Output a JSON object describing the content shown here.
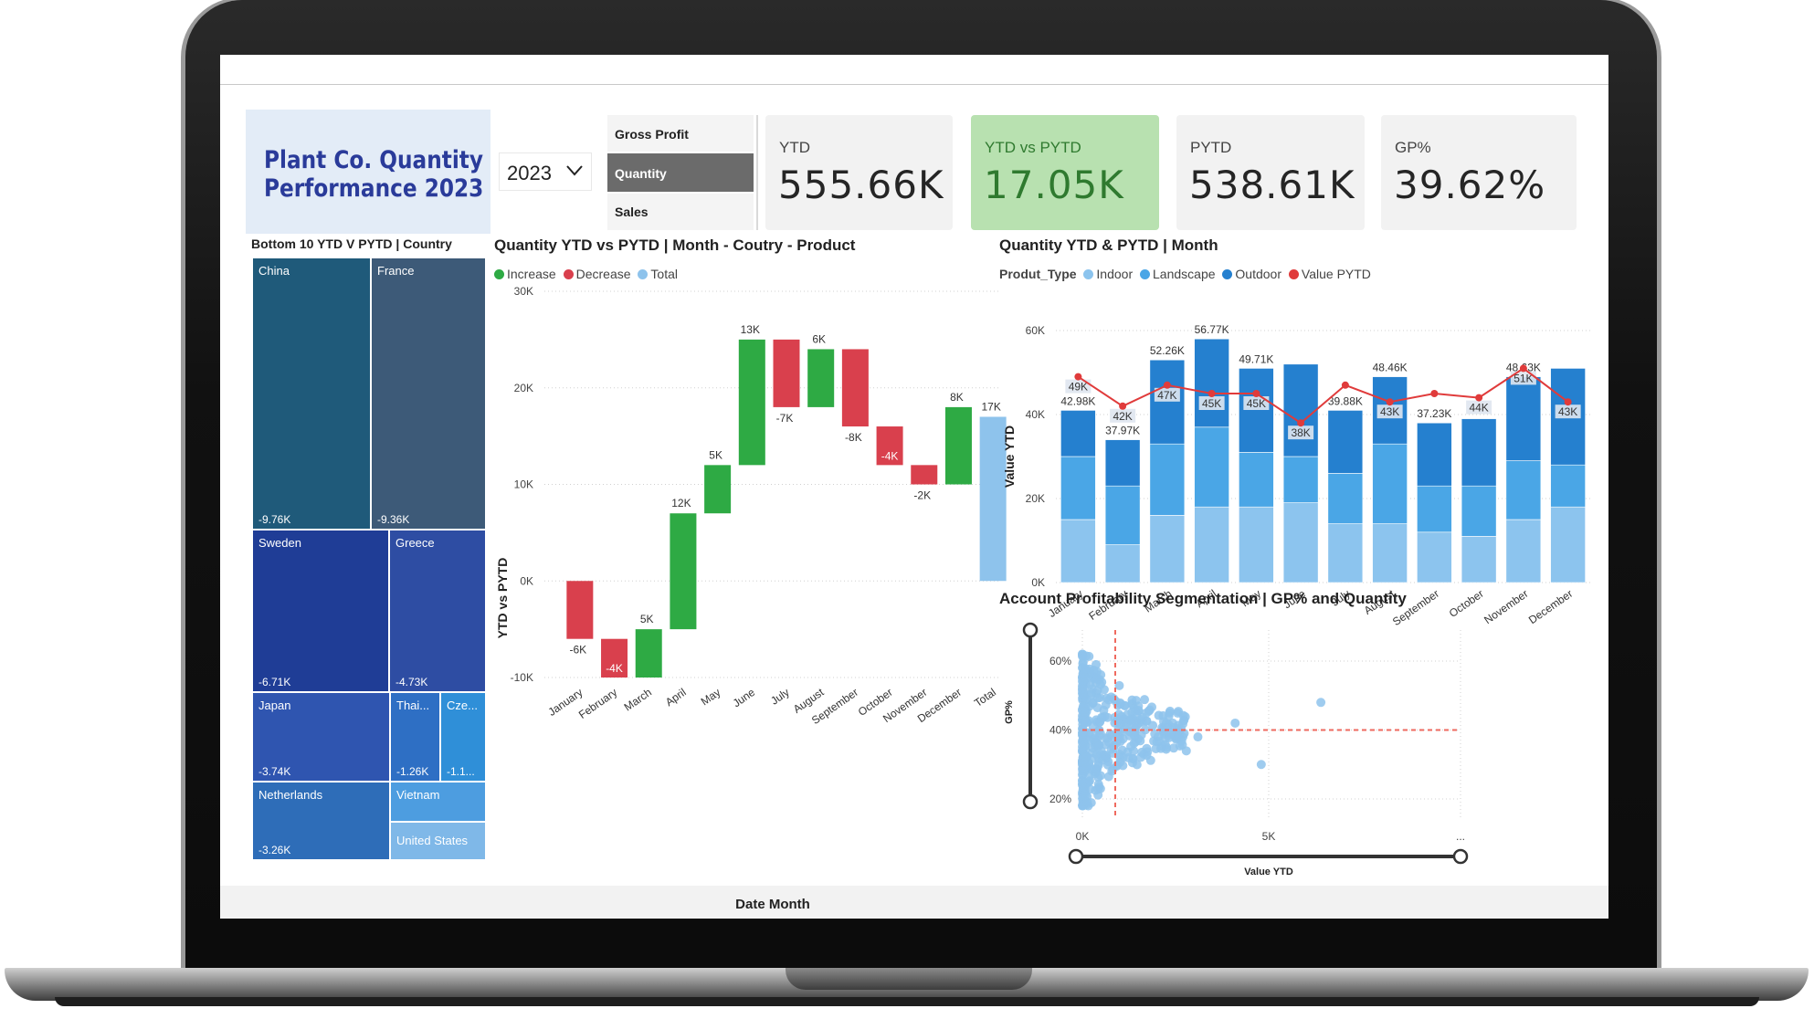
{
  "header": {
    "title_line1": "Plant Co. Quantity",
    "title_line2": "Performance 2023"
  },
  "year_filter": {
    "selected": "2023"
  },
  "metric_selector": {
    "options": [
      "Gross Profit",
      "Quantity",
      "Sales"
    ],
    "selected": "Quantity"
  },
  "kpis": [
    {
      "label": "YTD",
      "value": "555.66K"
    },
    {
      "label": "YTD vs PYTD",
      "value": "17.05K"
    },
    {
      "label": "PYTD",
      "value": "538.61K"
    },
    {
      "label": "GP%",
      "value": "39.62%"
    }
  ],
  "colors": {
    "title_bg": "#e3ecf7",
    "title_text": "#2a3b9a",
    "kpi_highlight": "#b8e1b0",
    "kpi_highlight_text": "#2f7a2f",
    "increase": "#2eaa44",
    "decrease": "#d9404d",
    "total": "#8ec3ec",
    "indoor": "#8cc4ee",
    "landscape": "#4aa6e6",
    "outdoor": "#2580cf",
    "value_pytd": "#e03b3b",
    "scatter": "#8ec3ec"
  },
  "treemap": {
    "title": "Bottom 10 YTD V PYTD | Country",
    "items": [
      {
        "name": "China",
        "value": "-9.76K",
        "color": "#1f5a7a"
      },
      {
        "name": "France",
        "value": "-9.36K",
        "color": "#3d5a78"
      },
      {
        "name": "Sweden",
        "value": "-6.71K",
        "color": "#1f3d96"
      },
      {
        "name": "Greece",
        "value": "-4.73K",
        "color": "#2e4da3"
      },
      {
        "name": "Japan",
        "value": "-3.74K",
        "color": "#2f55b0"
      },
      {
        "name": "Thai...",
        "value": "-1.26K",
        "color": "#2e6fc4"
      },
      {
        "name": "Cze...",
        "value": "-1.1...",
        "color": "#2f8fd8"
      },
      {
        "name": "Netherlands",
        "value": "-3.26K",
        "color": "#2e6db8"
      },
      {
        "name": "Vietnam",
        "value": "",
        "color": "#4d9de0"
      },
      {
        "name": "United States",
        "value": "",
        "color": "#7fb8e8"
      }
    ]
  },
  "waterfall": {
    "title": "Quantity YTD vs PYTD | Month - Coutry - Product",
    "legend": [
      "Increase",
      "Decrease",
      "Total"
    ],
    "xlabel": "Date Month",
    "ylabel": "YTD vs PYTD",
    "y_ticks": [
      "30K",
      "20K",
      "10K",
      "0K",
      "-10K"
    ]
  },
  "combo": {
    "title": "Quantity YTD & PYTD | Month",
    "legend_title": "Produt_Type",
    "legend": [
      "Indoor",
      "Landscape",
      "Outdoor",
      "Value PYTD"
    ],
    "ylabel": "Value YTD",
    "y_ticks": [
      "60K",
      "40K",
      "20K",
      "0K"
    ]
  },
  "scatter": {
    "title": "Account Profitability Segmentation | GP% and Quantity",
    "xlabel": "Value YTD",
    "ylabel": "GP%",
    "x_ticks": [
      "0K",
      "5K",
      "..."
    ],
    "y_ticks": [
      "60%",
      "40%",
      "20%"
    ]
  },
  "chart_data": [
    {
      "type": "bar",
      "subtype": "waterfall",
      "categories": [
        "January",
        "February",
        "March",
        "April",
        "May",
        "June",
        "July",
        "August",
        "September",
        "October",
        "November",
        "December",
        "Total"
      ],
      "values": [
        -6,
        -4,
        5,
        12,
        5,
        13,
        -7,
        6,
        -8,
        -4,
        -2,
        8,
        17
      ],
      "labels": [
        "-6K",
        "-4K",
        "5K",
        "12K",
        "5K",
        "13K",
        "-7K",
        "6K",
        "-8K",
        "-4K",
        "-2K",
        "8K",
        "17K"
      ],
      "ylim": [
        -10,
        30
      ],
      "title": "Quantity YTD vs PYTD | Month - Coutry - Product",
      "xlabel": "Date Month",
      "ylabel": "YTD vs PYTD"
    },
    {
      "type": "bar",
      "subtype": "stacked-bar-with-line",
      "categories": [
        "January",
        "February",
        "March",
        "April",
        "May",
        "June",
        "July",
        "August",
        "September",
        "October",
        "November",
        "December"
      ],
      "series": [
        {
          "name": "Indoor",
          "values": [
            15,
            9,
            16,
            18,
            18,
            19,
            14,
            14,
            12,
            11,
            15,
            18
          ]
        },
        {
          "name": "Landscape",
          "values": [
            15,
            14,
            17,
            19,
            13,
            11,
            12,
            19,
            11,
            12,
            14,
            10
          ]
        },
        {
          "name": "Outdoor",
          "values": [
            11,
            11,
            20,
            21,
            20,
            22,
            15,
            16,
            15,
            16,
            20,
            23
          ]
        },
        {
          "name": "Value PYTD",
          "type": "line",
          "values": [
            49,
            42,
            47,
            45,
            45,
            38,
            47,
            43,
            45,
            44,
            51,
            43
          ]
        }
      ],
      "data_labels": {
        "totals": [
          "42.98K",
          "37.97K",
          "52.26K",
          "56.77K",
          "49.71K",
          "",
          "39.88K",
          "48.46K",
          "37.23K",
          "",
          "48.63K",
          ""
        ],
        "pytd": [
          "49K",
          "42K",
          "47K",
          "45K",
          "45K",
          "38K",
          "",
          "43K",
          "",
          "44K",
          "51K",
          "43K"
        ]
      },
      "ylim": [
        0,
        60
      ],
      "title": "Quantity YTD & PYTD | Month",
      "ylabel": "Value YTD"
    },
    {
      "type": "scatter",
      "title": "Account Profitability Segmentation | GP% and Quantity",
      "xlabel": "Value YTD",
      "ylabel": "GP%",
      "x_ticks": [
        "0K",
        "5K"
      ],
      "y_ticks": [
        "60%",
        "40%",
        "20%"
      ],
      "reference_lines": {
        "x": 0.9,
        "y": 40
      },
      "points_note_outliers": [
        [
          3.1,
          38
        ],
        [
          4.1,
          42
        ],
        [
          4.8,
          30
        ],
        [
          6.4,
          48
        ]
      ]
    }
  ]
}
